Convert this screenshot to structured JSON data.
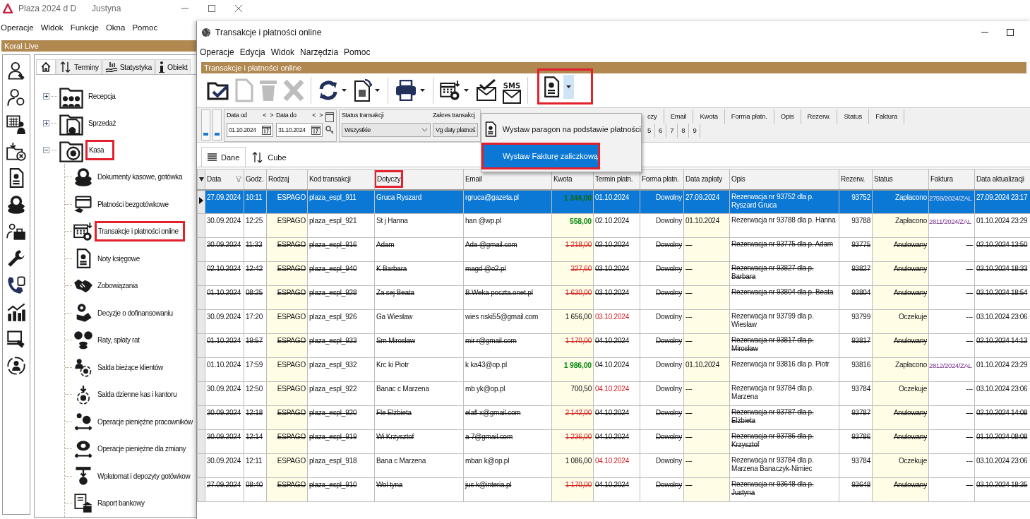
{
  "main_window": {
    "title": "Plaza 2024 d D",
    "user": "Justyna",
    "menu": [
      "Operacje",
      "Widok",
      "Funkcje",
      "Okna",
      "Pomoc"
    ],
    "panel_title": "Koral Live",
    "tabs": [
      {
        "kind": "home",
        "selected": true
      },
      {
        "kind": "arrows",
        "label": "Terminy",
        "selected": false
      },
      {
        "kind": "chart",
        "label": "Statystyka",
        "selected": false
      },
      {
        "kind": "info",
        "label": "Obiekt",
        "selected": false
      }
    ],
    "tree": [
      {
        "label": "Recepcja",
        "expanded": false,
        "highlighted": false
      },
      {
        "label": "Sprzedaż",
        "expanded": false,
        "highlighted": false
      },
      {
        "label": "Kasa",
        "expanded": true,
        "highlighted": true,
        "children": [
          {
            "label": "Dokumenty kasowe, gotówka",
            "highlighted": false
          },
          {
            "label": "Płatności bezgotówkowe",
            "highlighted": false
          },
          {
            "label": "Transakcje i płatności online",
            "highlighted": true
          },
          {
            "label": "Noty księgowe",
            "highlighted": false
          },
          {
            "label": "Zobowiązania",
            "highlighted": false
          },
          {
            "label": "Decyzje o dofinansowaniu",
            "highlighted": false
          },
          {
            "label": "Raty, spłaty rat",
            "highlighted": false
          },
          {
            "label": "Salda bieżące klientów",
            "highlighted": false
          },
          {
            "label": "Salda dzienne kas i kantoru",
            "highlighted": false
          },
          {
            "label": "Operacje pieniężne pracowników",
            "highlighted": false
          },
          {
            "label": "Operacje pieniężne dla zmiany",
            "highlighted": false
          },
          {
            "label": "Wpłatomat i depozyty gotówkow",
            "highlighted": false
          },
          {
            "label": "Raport bankowy",
            "highlighted": false
          }
        ]
      }
    ]
  },
  "child_window": {
    "title": "Transakcje i płatności online",
    "menu": [
      "Operacje",
      "Edycja",
      "Widok",
      "Narzędzia",
      "Pomoc"
    ],
    "panel_title": "Transakcje i płatności online",
    "toolbar": [
      {
        "kind": "open",
        "disabled": false,
        "dropdown": false,
        "highlighted": false
      },
      {
        "kind": "new",
        "disabled": true,
        "dropdown": false,
        "highlighted": false
      },
      {
        "kind": "delete",
        "disabled": true,
        "dropdown": false,
        "highlighted": false
      },
      {
        "kind": "cancel",
        "disabled": true,
        "dropdown": false,
        "highlighted": false
      },
      {
        "kind": "refresh",
        "disabled": false,
        "dropdown": true,
        "highlighted": false
      },
      {
        "kind": "export",
        "disabled": false,
        "dropdown": true,
        "highlighted": false
      },
      {
        "kind": "print",
        "disabled": false,
        "dropdown": true,
        "highlighted": false
      },
      {
        "kind": "calendar",
        "disabled": false,
        "dropdown": true,
        "highlighted": false
      },
      {
        "kind": "mail",
        "disabled": false,
        "dropdown": false,
        "highlighted": false
      },
      {
        "kind": "sms",
        "label": "SMS",
        "disabled": false,
        "dropdown": false,
        "highlighted": false
      },
      {
        "kind": "receipt",
        "disabled": false,
        "dropdown": true,
        "highlighted": true
      }
    ],
    "filters": {
      "date_from": {
        "label": "Data od",
        "prev": "<",
        "next": ">",
        "value": "01.10.2024"
      },
      "date_to": {
        "label": "Data do",
        "prev": "<",
        "next": ">",
        "value": "31.10.2024"
      },
      "status": {
        "label": "Status transakcji",
        "value": "Wszystkie"
      },
      "range": {
        "label": "Zakres transakcj",
        "value": "Vg daty płatnoś"
      }
    },
    "group_bar": {
      "columns": [
        "czy",
        "Email",
        "Kwota",
        "Forma płatn.",
        "Opis",
        "Rezerw.",
        "Status",
        "Faktura"
      ],
      "numbers": [
        "5",
        "6",
        "7",
        "8",
        "9"
      ]
    },
    "dropdown_menu": [
      {
        "label": "Wystaw paragon na podstawie płatności",
        "selected": false,
        "highlighted": false
      },
      {
        "label": "Wystaw Fakturę zaliczkową",
        "selected": true,
        "highlighted": true
      }
    ],
    "view_tabs": [
      {
        "label": "Dane",
        "kind": "list",
        "selected": true
      },
      {
        "label": "Cube",
        "kind": "cube",
        "selected": false
      }
    ],
    "table": {
      "columns": [
        {
          "label": "Data",
          "highlighted": false
        },
        {
          "label": "Godz.",
          "highlighted": false
        },
        {
          "label": "Rodzaj",
          "highlighted": false
        },
        {
          "label": "Kod transakcji",
          "highlighted": false
        },
        {
          "label": "Dotyczy",
          "highlighted": true
        },
        {
          "label": "Email",
          "highlighted": false
        },
        {
          "label": "Kwota",
          "highlighted": false
        },
        {
          "label": "Termin płatn.",
          "highlighted": false
        },
        {
          "label": "Forma płatn.",
          "highlighted": false
        },
        {
          "label": "Data zapłaty",
          "highlighted": false
        },
        {
          "label": "Opis",
          "highlighted": false
        },
        {
          "label": "Rezerw.",
          "highlighted": false
        },
        {
          "label": "Status",
          "highlighted": false
        },
        {
          "label": "Faktura",
          "highlighted": false
        },
        {
          "label": "Data aktualizacji",
          "highlighted": false
        }
      ],
      "rows": [
        {
          "selected": true,
          "kind": "paid",
          "overdue": false,
          "date": "27.09.2024",
          "time": "10:11",
          "type": "ESPAGO",
          "code": "plaza_espl_911",
          "subject": "Gruca Ryszard",
          "email": "rgruca@gazeta.pl",
          "amount": "1 344,00",
          "due": "01.10.2024",
          "form": "Dowolny",
          "paid_date": "27.09.2024",
          "description": "Rezerwacja nr 93752 dla p. Ryszard Gruca",
          "reservation": "93752",
          "status": "Zapłacono",
          "invoice": "2759/2024/ZAL",
          "updated": "27.09.2024 23:17"
        },
        {
          "selected": false,
          "kind": "paid",
          "overdue": false,
          "date": "30.09.2024",
          "time": "12:25",
          "type": "ESPAGO",
          "code": "plaza_espl_921",
          "subject": "St j Hanna",
          "email": "han @wp.pl",
          "amount": "558,00",
          "due": "02.10.2024",
          "form": "Dowolny",
          "paid_date": "01.10.2024",
          "description": "Rezerwacja nr 93788 dla p. Hanna",
          "reservation": "93788",
          "status": "Zapłacono",
          "invoice": "2811/2024/ZAL",
          "updated": "01.10.2024 23:29"
        },
        {
          "selected": false,
          "kind": "cancelled",
          "overdue": false,
          "date": "30.09.2024",
          "time": "11:33",
          "type": "ESPAGO",
          "code": "plaza_espl_916",
          "subject": "Adam",
          "email": "Ada @gmail.com",
          "amount": "1 218,00",
          "due": "02.10.2024",
          "form": "Dowolny",
          "paid_date": "---",
          "description": "Rezerwacja nr 93775 dla p. Adam",
          "reservation": "93775",
          "status": "Anulowany",
          "invoice": "---",
          "updated": "02.10.2024 13:50"
        },
        {
          "selected": false,
          "kind": "cancelled",
          "overdue": false,
          "date": "02.10.2024",
          "time": "12:42",
          "type": "ESPAGO",
          "code": "plaza_espl_940",
          "subject": "K Barbara",
          "email": "magd @o2.pl",
          "amount": "327,60",
          "due": "03.10.2024",
          "form": "Dowolny",
          "paid_date": "---",
          "description": "Rezerwacja nr 93827 dla p. Barbara",
          "reservation": "93827",
          "status": "Anulowany",
          "invoice": "---",
          "updated": "03.10.2024 18:33"
        },
        {
          "selected": false,
          "kind": "cancelled",
          "overdue": false,
          "date": "01.10.2024",
          "time": "08:25",
          "type": "ESPAGO",
          "code": "plaza_espl_928",
          "subject": "Za sej Beata",
          "email": "B.Weka poczta.onet.pl",
          "amount": "1 630,00",
          "due": "03.10.2024",
          "form": "Dowolny",
          "paid_date": "---",
          "description": "Rezerwacja nr 93804 dla p. Beata",
          "reservation": "93804",
          "status": "Anulowany",
          "invoice": "---",
          "updated": "03.10.2024 18:54"
        },
        {
          "selected": false,
          "kind": "pending",
          "overdue": true,
          "date": "30.09.2024",
          "time": "17:20",
          "type": "ESPAGO",
          "code": "plaza_espl_926",
          "subject": "Ga Wiesław",
          "email": "wies nski55@gmail.com",
          "amount": "1 656,00",
          "due": "03.10.2024",
          "form": "Dowolny",
          "paid_date": "---",
          "description": "Rezerwacja nr 93799 dla p. Wiesław",
          "reservation": "93799",
          "status": "Oczekuje",
          "invoice": "---",
          "updated": "03.10.2024 23:06"
        },
        {
          "selected": false,
          "kind": "cancelled",
          "overdue": false,
          "date": "01.10.2024",
          "time": "19:57",
          "type": "ESPAGO",
          "code": "plaza_espl_933",
          "subject": "Sm Mirosław",
          "email": "mir r@gmail.com",
          "amount": "1 170,00",
          "due": "04.10.2024",
          "form": "Dowolny",
          "paid_date": "---",
          "description": "Rezerwacja nr 93817 dla p. Mirosław",
          "reservation": "93817",
          "status": "Anulowany",
          "invoice": "---",
          "updated": "02.10.2024 14:13"
        },
        {
          "selected": false,
          "kind": "paid",
          "overdue": false,
          "date": "01.10.2024",
          "time": "17:59",
          "type": "ESPAGO",
          "code": "plaza_espl_932",
          "subject": "Krc ki Piotr",
          "email": "k ka43@op.pl",
          "amount": "1 986,00",
          "due": "04.10.2024",
          "form": "Dowolny",
          "paid_date": "01.10.2024",
          "description": "Rezerwacja nr 93816 dla p. Piotr",
          "reservation": "93816",
          "status": "Zapłacono",
          "invoice": "2812/2024/ZAL",
          "updated": "01.10.2024 23:29"
        },
        {
          "selected": false,
          "kind": "pending",
          "overdue": true,
          "date": "30.09.2024",
          "time": "12:50",
          "type": "ESPAGO",
          "code": "plaza_espl_922",
          "subject": "Banac c Marzena",
          "email": "mb yk@op.pl",
          "amount": "700,50",
          "due": "04.10.2024",
          "form": "Dowolny",
          "paid_date": "---",
          "description": "Rezerwacja nr 93784 dla p. Marzena",
          "reservation": "93784",
          "status": "Oczekuje",
          "invoice": "---",
          "updated": "03.10.2024 23:06"
        },
        {
          "selected": false,
          "kind": "cancelled",
          "overdue": false,
          "date": "30.09.2024",
          "time": "12:18",
          "type": "ESPAGO",
          "code": "plaza_espl_920",
          "subject": "Fle Elżbieta",
          "email": "elafl x@gmail.com",
          "amount": "2 142,00",
          "due": "04.10.2024",
          "form": "Dowolny",
          "paid_date": "---",
          "description": "Rezerwacja nr 93787 dla p. Elżbieta",
          "reservation": "93787",
          "status": "Anulowany",
          "invoice": "---",
          "updated": "02.10.2024 14:08"
        },
        {
          "selected": false,
          "kind": "cancelled",
          "overdue": false,
          "date": "30.09.2024",
          "time": "12:14",
          "type": "ESPAGO",
          "code": "plaza_espl_919",
          "subject": "Wi Krzysztof",
          "email": "a 7@gmail.com",
          "amount": "1 236,00",
          "due": "04.10.2024",
          "form": "Dowolny",
          "paid_date": "---",
          "description": "Rezerwacja nr 93786 dla p. Krzysztof",
          "reservation": "93786",
          "status": "Anulowany",
          "invoice": "---",
          "updated": "01.10.2024 08:08"
        },
        {
          "selected": false,
          "kind": "pending",
          "overdue": true,
          "date": "30.09.2024",
          "time": "12:11",
          "type": "ESPAGO",
          "code": "plaza_espl_918",
          "subject": "Bana c Marzena",
          "email": "mban k@op.pl",
          "amount": "1 086,00",
          "due": "04.10.2024",
          "form": "Dowolny",
          "paid_date": "---",
          "description": "Rezerwacja nr 93784 dla p. Marzena Banaczyk-Nimiec",
          "reservation": "93784",
          "status": "Oczekuje",
          "invoice": "---",
          "updated": "03.10.2024 23:06"
        },
        {
          "selected": false,
          "kind": "cancelled",
          "overdue": false,
          "date": "27.09.2024",
          "time": "08:40",
          "type": "ESPAGO",
          "code": "plaza_espl_910",
          "subject": "Wol tyna",
          "email": "jus k@interia.pl",
          "amount": "1 170,00",
          "due": "04.10.2024",
          "form": "Dowolny",
          "paid_date": "---",
          "description": "Rezerwacja nr 93648 dla p. Justyna",
          "reservation": "93648",
          "status": "Anulowany",
          "invoice": "---",
          "updated": "03.10.2024 18:35"
        }
      ]
    }
  }
}
